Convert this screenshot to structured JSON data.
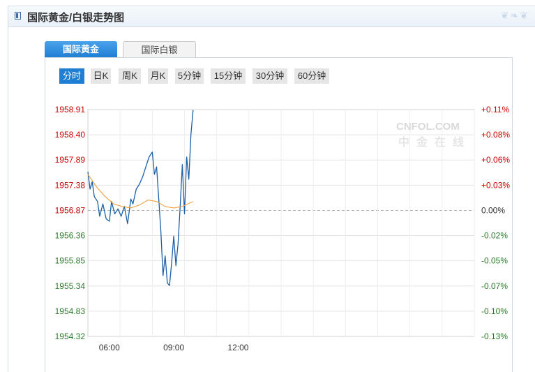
{
  "header": {
    "title": "国际黄金/白银走势图"
  },
  "tabs": [
    {
      "label": "国际黄金",
      "active": true
    },
    {
      "label": "国际白银",
      "active": false
    }
  ],
  "periods": [
    {
      "label": "分时",
      "active": true
    },
    {
      "label": "日K",
      "active": false
    },
    {
      "label": "周K",
      "active": false
    },
    {
      "label": "月K",
      "active": false
    },
    {
      "label": "5分钟",
      "active": false
    },
    {
      "label": "15分钟",
      "active": false
    },
    {
      "label": "30分钟",
      "active": false
    },
    {
      "label": "60分钟",
      "active": false
    }
  ],
  "watermark": {
    "brand": "CNFOL.COM",
    "tagline": "中金在线"
  },
  "colors": {
    "up": "#cc0000",
    "down": "#2a7a2a",
    "price_line": "#1a5fa8",
    "avg_line": "#f0a040",
    "accent": "#1f7fd4"
  },
  "chart_data": {
    "type": "line",
    "title": "",
    "xlabel": "",
    "ylabel": "",
    "ylim": [
      1954.32,
      1958.91
    ],
    "ref_price": 1956.87,
    "y_ticks_left": [
      "1958.91",
      "1958.40",
      "1957.89",
      "1957.38",
      "1956.87",
      "1956.36",
      "1955.85",
      "1955.34",
      "1954.83",
      "1954.32"
    ],
    "y_ticks_right": [
      "+0.11%",
      "+0.08%",
      "+0.06%",
      "+0.03%",
      "0.00%",
      "-0.02%",
      "-0.05%",
      "-0.07%",
      "-0.10%",
      "-0.13%"
    ],
    "x_ticks": [
      "06:00",
      "09:00",
      "12:00"
    ],
    "x_range_hours": [
      5.0,
      23.0
    ],
    "series": [
      {
        "x": [
          5.0,
          5.1,
          5.2,
          5.3,
          5.45,
          5.55,
          5.7,
          5.85,
          6.0,
          6.1,
          6.25,
          6.4,
          6.55,
          6.7,
          6.85,
          7.0,
          7.1,
          7.25,
          7.4,
          7.55,
          7.7,
          7.85,
          8.0,
          8.1,
          8.2,
          8.3,
          8.4,
          8.5,
          8.6,
          8.7,
          8.8,
          8.9,
          9.0,
          9.1,
          9.2,
          9.3,
          9.4,
          9.5,
          9.6,
          9.7,
          9.8,
          9.9
        ],
        "y": [
          1957.65,
          1957.3,
          1957.45,
          1957.15,
          1957.05,
          1956.75,
          1957.0,
          1956.7,
          1956.65,
          1957.05,
          1956.8,
          1956.9,
          1956.75,
          1956.95,
          1956.6,
          1957.1,
          1957.0,
          1957.3,
          1957.4,
          1957.55,
          1957.75,
          1957.95,
          1958.05,
          1957.6,
          1957.75,
          1957.1,
          1956.45,
          1955.55,
          1955.95,
          1955.4,
          1955.35,
          1955.8,
          1956.35,
          1955.75,
          1956.2,
          1956.95,
          1957.8,
          1956.8,
          1957.95,
          1957.5,
          1958.4,
          1958.9
        ]
      },
      {
        "x": [
          5.0,
          5.4,
          5.8,
          6.2,
          6.6,
          7.0,
          7.4,
          7.8,
          8.2,
          8.6,
          9.0,
          9.4,
          9.9
        ],
        "y": [
          1957.6,
          1957.35,
          1957.15,
          1957.0,
          1956.95,
          1956.92,
          1956.98,
          1957.08,
          1957.05,
          1956.95,
          1956.92,
          1956.95,
          1957.05
        ]
      }
    ]
  }
}
